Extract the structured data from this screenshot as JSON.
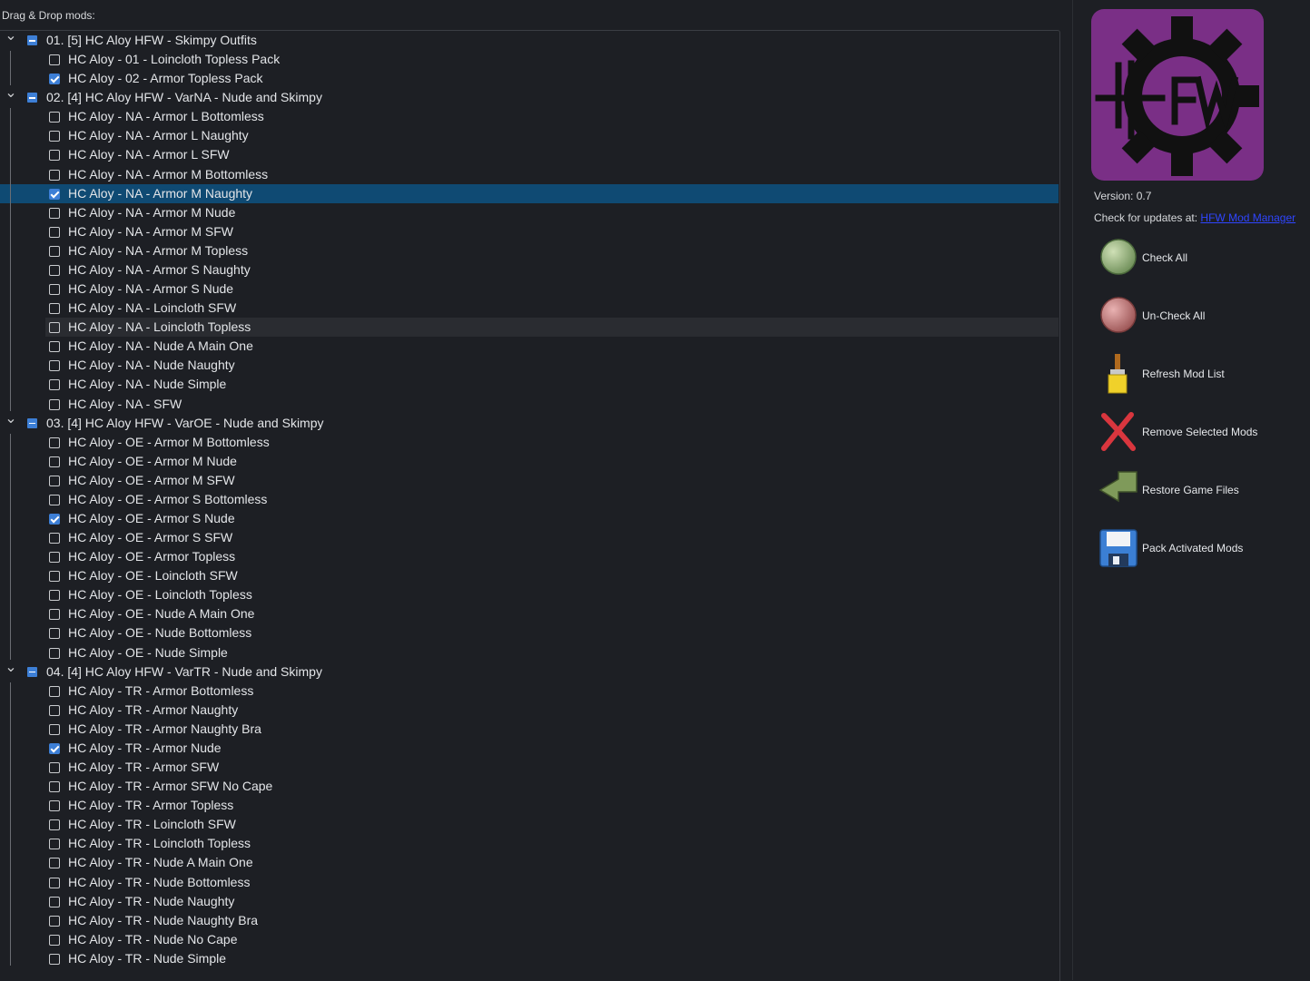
{
  "drag_label": "Drag & Drop mods:",
  "groups": [
    {
      "label": "01. [5] HC Aloy HFW - Skimpy Outfits",
      "items": [
        {
          "label": "HC Aloy - 01 - Loincloth Topless Pack",
          "checked": false
        },
        {
          "label": "HC Aloy - 02 - Armor Topless Pack",
          "checked": true
        }
      ]
    },
    {
      "label": "02. [4] HC Aloy HFW - VarNA - Nude and Skimpy",
      "items": [
        {
          "label": "HC Aloy - NA - Armor L Bottomless",
          "checked": false
        },
        {
          "label": "HC Aloy - NA - Armor L Naughty",
          "checked": false
        },
        {
          "label": "HC Aloy - NA - Armor L SFW",
          "checked": false
        },
        {
          "label": "HC Aloy - NA - Armor M Bottomless",
          "checked": false
        },
        {
          "label": "HC Aloy - NA - Armor M Naughty",
          "checked": true,
          "selected": true
        },
        {
          "label": "HC Aloy - NA - Armor M Nude",
          "checked": false
        },
        {
          "label": "HC Aloy - NA - Armor M SFW",
          "checked": false
        },
        {
          "label": "HC Aloy - NA - Armor M Topless",
          "checked": false
        },
        {
          "label": "HC Aloy - NA - Armor S Naughty",
          "checked": false
        },
        {
          "label": "HC Aloy - NA - Armor S Nude",
          "checked": false
        },
        {
          "label": "HC Aloy - NA - Loincloth SFW",
          "checked": false
        },
        {
          "label": "HC Aloy - NA - Loincloth Topless",
          "checked": false,
          "hovered": true
        },
        {
          "label": "HC Aloy - NA - Nude A Main One",
          "checked": false
        },
        {
          "label": "HC Aloy - NA - Nude Naughty",
          "checked": false
        },
        {
          "label": "HC Aloy - NA - Nude Simple",
          "checked": false
        },
        {
          "label": "HC Aloy - NA - SFW",
          "checked": false
        }
      ]
    },
    {
      "label": "03. [4] HC Aloy HFW - VarOE - Nude and Skimpy",
      "items": [
        {
          "label": "HC Aloy - OE - Armor M Bottomless",
          "checked": false
        },
        {
          "label": "HC Aloy - OE - Armor M Nude",
          "checked": false
        },
        {
          "label": "HC Aloy - OE - Armor M SFW",
          "checked": false
        },
        {
          "label": "HC Aloy - OE - Armor S Bottomless",
          "checked": false
        },
        {
          "label": "HC Aloy - OE - Armor S Nude",
          "checked": true
        },
        {
          "label": "HC Aloy - OE - Armor S SFW",
          "checked": false
        },
        {
          "label": "HC Aloy - OE - Armor Topless",
          "checked": false
        },
        {
          "label": "HC Aloy - OE - Loincloth SFW",
          "checked": false
        },
        {
          "label": "HC Aloy - OE - Loincloth Topless",
          "checked": false
        },
        {
          "label": "HC Aloy - OE - Nude A Main One",
          "checked": false
        },
        {
          "label": "HC Aloy - OE - Nude Bottomless",
          "checked": false
        },
        {
          "label": "HC Aloy - OE - Nude Simple",
          "checked": false
        }
      ]
    },
    {
      "label": "04. [4] HC Aloy HFW - VarTR - Nude and Skimpy",
      "items": [
        {
          "label": "HC Aloy - TR - Armor Bottomless",
          "checked": false
        },
        {
          "label": "HC Aloy - TR - Armor Naughty",
          "checked": false
        },
        {
          "label": "HC Aloy - TR - Armor Naughty Bra",
          "checked": false
        },
        {
          "label": "HC Aloy - TR - Armor Nude",
          "checked": true
        },
        {
          "label": "HC Aloy - TR - Armor SFW",
          "checked": false
        },
        {
          "label": "HC Aloy - TR - Armor SFW No Cape",
          "checked": false
        },
        {
          "label": "HC Aloy - TR - Armor Topless",
          "checked": false
        },
        {
          "label": "HC Aloy - TR - Loincloth SFW",
          "checked": false
        },
        {
          "label": "HC Aloy - TR - Loincloth Topless",
          "checked": false
        },
        {
          "label": "HC Aloy - TR - Nude A Main One",
          "checked": false
        },
        {
          "label": "HC Aloy - TR - Nude Bottomless",
          "checked": false
        },
        {
          "label": "HC Aloy - TR - Nude Naughty",
          "checked": false
        },
        {
          "label": "HC Aloy - TR - Nude Naughty Bra",
          "checked": false
        },
        {
          "label": "HC Aloy - TR - Nude No Cape",
          "checked": false
        },
        {
          "label": "HC Aloy - TR - Nude Simple",
          "checked": false
        }
      ]
    }
  ],
  "sidebar": {
    "logo_text": "HFW",
    "logo_color": "#7a2f86",
    "version": "Version: 0.7",
    "updates_prefix": "Check for updates at:",
    "updates_link": "HFW Mod Manager",
    "actions": [
      {
        "label": "Check All",
        "icon": "green-circle-icon"
      },
      {
        "label": "Un-Check All",
        "icon": "red-circle-icon"
      },
      {
        "label": "Refresh Mod List",
        "icon": "paintbrush-icon"
      },
      {
        "label": "Remove Selected Mods",
        "icon": "red-x-icon"
      },
      {
        "label": "Restore Game Files",
        "icon": "return-arrow-icon"
      },
      {
        "label": "Pack Activated Mods",
        "icon": "floppy-disk-icon"
      }
    ]
  },
  "colors": {
    "background": "#1d1f24",
    "selected_row": "#0f4a73",
    "checkbox_checked": "#3d7fd6"
  }
}
